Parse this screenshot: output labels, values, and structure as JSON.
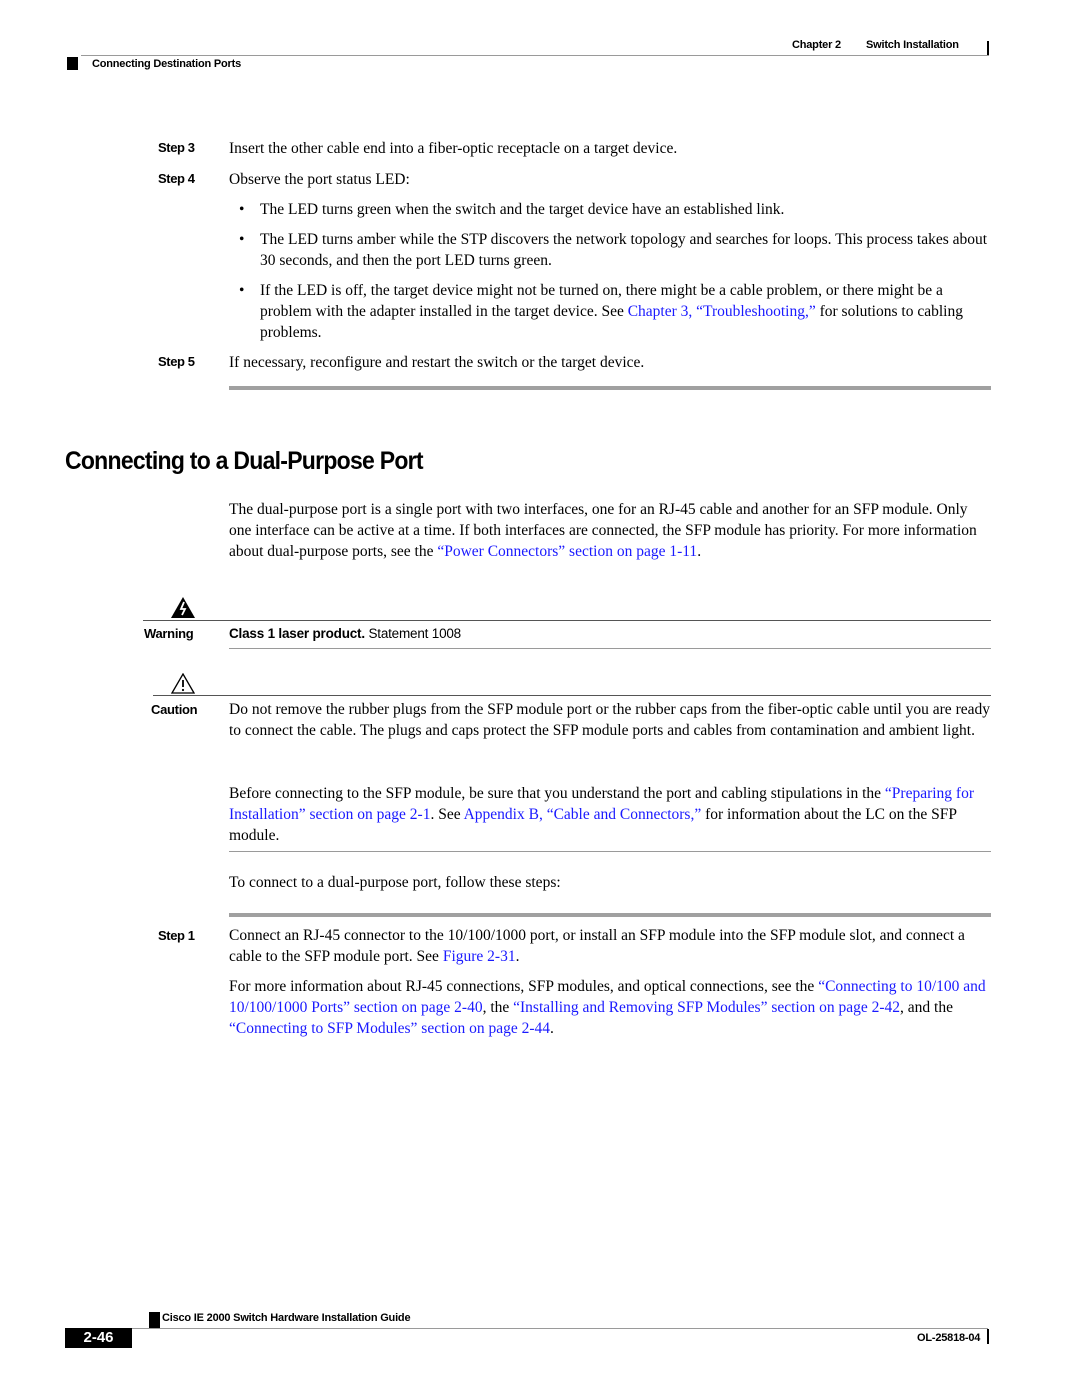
{
  "header": {
    "chapter": "Chapter 2",
    "chapter_title": "Switch Installation",
    "section": "Connecting Destination Ports"
  },
  "steps_top": [
    {
      "label": "Step 3",
      "text": "Insert the other cable end into a fiber-optic receptacle on a target device."
    },
    {
      "label": "Step 4",
      "text": "Observe the port status LED:"
    }
  ],
  "bullets": [
    {
      "text": "The LED turns green when the switch and the target device have an established link."
    },
    {
      "text": "The LED turns amber while the STP discovers the network topology and searches for loops. This process takes about 30 seconds, and then the port LED turns green."
    },
    {
      "text_before": "If the LED is off, the target device might not be turned on, there might be a cable problem, or there might be a problem with the adapter installed in the target device. See ",
      "link": "Chapter 3, “Troubleshooting,”",
      "text_after": " for solutions to cabling problems."
    }
  ],
  "step5": {
    "label": "Step 5",
    "text": "If necessary, reconfigure and restart the switch or the target device."
  },
  "section_title": "Connecting to a Dual-Purpose Port",
  "intro": {
    "text_before": "The dual-purpose port is a single port with two interfaces, one for an RJ-45 cable and another for an SFP module. Only one interface can be active at a time. If both interfaces are connected, the SFP module has priority. For more information about dual-purpose ports, see the ",
    "link": "“Power Connectors” section on page 1-11",
    "text_after": "."
  },
  "warning": {
    "icon": "warning-lightning-triangle-icon",
    "label": "Warning",
    "bold": "Class 1 laser product.",
    "text": " Statement 1008"
  },
  "caution": {
    "icon": "caution-exclamation-triangle-icon",
    "label": "Caution",
    "text": "Do not remove the rubber plugs from the SFP module port or the rubber caps from the fiber-optic cable until you are ready to connect the cable. The plugs and caps protect the SFP module ports and cables from contamination and ambient light."
  },
  "before_para": {
    "t1": "Before connecting to the SFP module, be sure that you understand the port and cabling stipulations in the ",
    "link1": "“Preparing for Installation” section on page 2-1",
    "t2": ". See ",
    "link2": "Appendix B, “Cable and Connectors,”",
    "t3": " for information about the LC on the SFP module."
  },
  "to_connect": "To connect to a dual-purpose port, follow these steps:",
  "step1": {
    "label": "Step 1",
    "text_before": "Connect an RJ-45 connector to the 10/100/1000 port, or install an SFP module into the SFP module slot, and connect a cable to the SFP module port. See ",
    "link": "Figure 2-31",
    "text_after": "."
  },
  "more_info": {
    "t1": "For more information about RJ-45 connections, SFP modules, and optical connections, see the ",
    "link1": "“Connecting to 10/100 and 10/100/1000 Ports” section on page 2-40",
    "t2": ", the ",
    "link2": "“Installing and Removing SFP Modules” section on page 2-42",
    "t3": ", and the ",
    "link3": "“Connecting to SFP Modules” section on page 2-44",
    "t4": "."
  },
  "footer": {
    "guide_title": "Cisco IE 2000 Switch Hardware Installation Guide",
    "page_number": "2-46",
    "doc_number": "OL-25818-04"
  },
  "colors": {
    "link": "#1a1aff",
    "rule": "#9a9a9a"
  }
}
